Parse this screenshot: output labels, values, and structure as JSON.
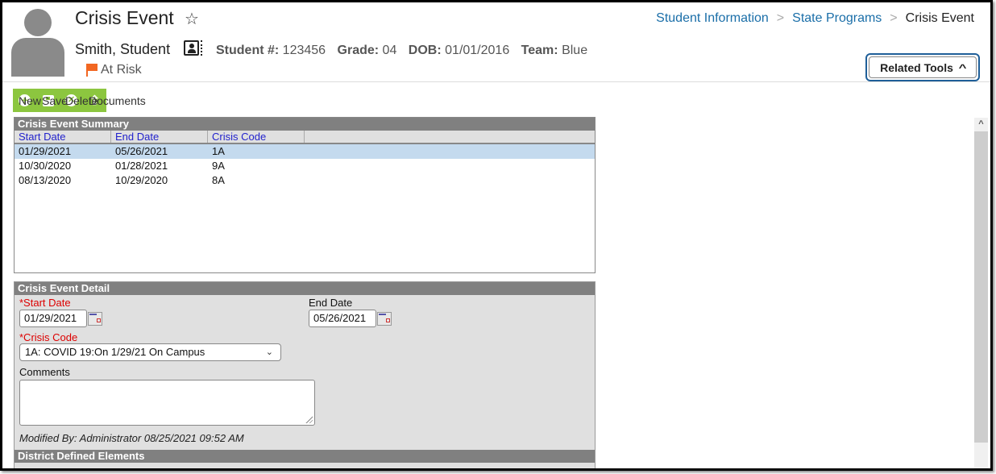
{
  "header": {
    "title": "Crisis Event",
    "student_name": "Smith, Student",
    "meta": [
      {
        "label": "Student #:",
        "value": "123456"
      },
      {
        "label": "Grade:",
        "value": "04"
      },
      {
        "label": "DOB:",
        "value": "01/01/2016"
      },
      {
        "label": "Team:",
        "value": "Blue"
      }
    ],
    "flag_text": "At Risk",
    "flag_color": "#f26722"
  },
  "breadcrumb": [
    {
      "label": "Student Information"
    },
    {
      "label": "State Programs"
    },
    {
      "label": "Crisis Event"
    }
  ],
  "related_tools": {
    "label": "Related Tools"
  },
  "toolbar": {
    "new": "New",
    "save": "Save",
    "delete": "Delete",
    "documents": "Documents",
    "accent": "#8cc63f"
  },
  "summary": {
    "title": "Crisis Event Summary",
    "columns": [
      "Start Date",
      "End Date",
      "Crisis Code"
    ],
    "rows": [
      {
        "start": "01/29/2021",
        "end": "05/26/2021",
        "code": "1A",
        "selected": true
      },
      {
        "start": "10/30/2020",
        "end": "01/28/2021",
        "code": "9A",
        "selected": false
      },
      {
        "start": "08/13/2020",
        "end": "10/29/2020",
        "code": "8A",
        "selected": false
      }
    ]
  },
  "detail": {
    "title": "Crisis Event Detail",
    "start_label": "*Start Date",
    "start_value": "01/29/2021",
    "end_label": "End Date",
    "end_value": "05/26/2021",
    "code_label": "*Crisis Code",
    "code_value": "1A: COVID 19:On 1/29/21 On Campus",
    "comments_label": "Comments",
    "comments_value": "",
    "modified": "Modified By: Administrator 08/25/2021 09:52 AM",
    "district_title": "District Defined Elements"
  }
}
